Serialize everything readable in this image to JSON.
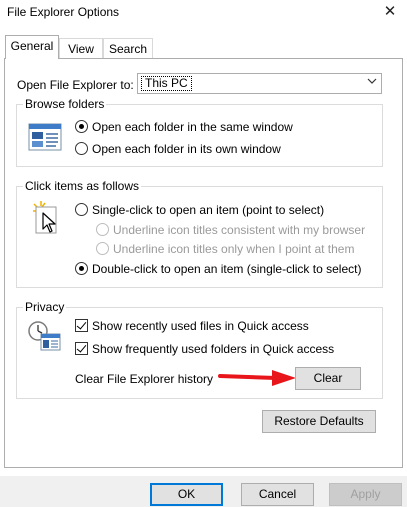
{
  "window": {
    "title": "File Explorer Options",
    "close_glyph": "✕"
  },
  "tabs": [
    {
      "label": "General",
      "active": true
    },
    {
      "label": "View",
      "active": false
    },
    {
      "label": "Search",
      "active": false
    }
  ],
  "open_to": {
    "label": "Open File Explorer to:",
    "selected": "This PC"
  },
  "browse_folders": {
    "title": "Browse folders",
    "options": [
      {
        "label": "Open each folder in the same window",
        "checked": true
      },
      {
        "label": "Open each folder in its own window",
        "checked": false
      }
    ]
  },
  "click_items": {
    "title": "Click items as follows",
    "single_click": "Single-click to open an item (point to select)",
    "underline_browser": "Underline icon titles consistent with my browser",
    "underline_point": "Underline icon titles only when I point at them",
    "double_click": "Double-click to open an item (single-click to select)"
  },
  "privacy": {
    "title": "Privacy",
    "recent_files": "Show recently used files in Quick access",
    "frequent_folders": "Show frequently used folders in Quick access",
    "clear_history_label": "Clear File Explorer history",
    "clear_button": "Clear"
  },
  "restore_defaults": "Restore Defaults",
  "footer": {
    "ok": "OK",
    "cancel": "Cancel",
    "apply": "Apply"
  },
  "colors": {
    "annotation_arrow": "#e8151b",
    "accent_border": "#0078d7"
  },
  "icons": [
    "close-icon",
    "chevron-down-icon",
    "browse-folders-icon",
    "click-items-icon",
    "privacy-icon",
    "red-arrow-annotation"
  ]
}
